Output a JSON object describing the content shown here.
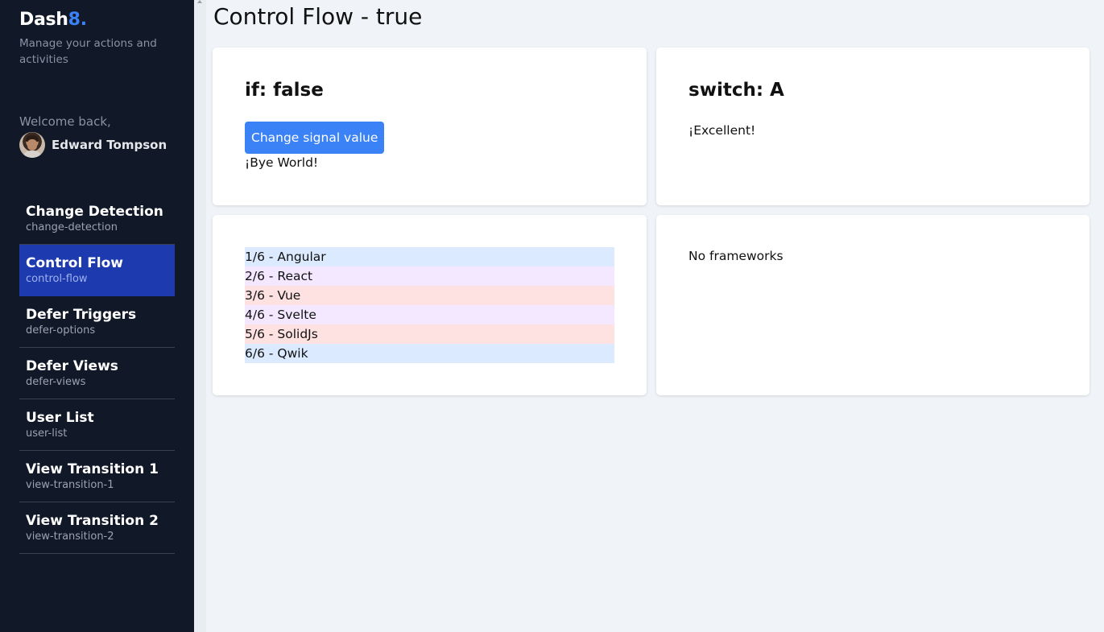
{
  "sidebar": {
    "brand_main": "Dash",
    "brand_accent": "8",
    "brand_suffix": ".",
    "tagline": "Manage your actions and activities",
    "welcome": "Welcome back,",
    "user_name": "Edward Tompson",
    "nav": [
      {
        "label": "Change Detection",
        "route": "change-detection",
        "active": false
      },
      {
        "label": "Control Flow",
        "route": "control-flow",
        "active": true
      },
      {
        "label": "Defer Triggers",
        "route": "defer-options",
        "active": false
      },
      {
        "label": "Defer Views",
        "route": "defer-views",
        "active": false
      },
      {
        "label": "User List",
        "route": "user-list",
        "active": false
      },
      {
        "label": "View Transition 1",
        "route": "view-transition-1",
        "active": false
      },
      {
        "label": "View Transition 2",
        "route": "view-transition-2",
        "active": false
      }
    ]
  },
  "main": {
    "title": "Control Flow - true",
    "if_card": {
      "heading": "if: false",
      "button_label": "Change signal value",
      "message": "¡Bye World!"
    },
    "switch_card": {
      "heading": "switch: A",
      "message": "¡Excellent!"
    },
    "framework_list": [
      {
        "text": "1/6 - Angular",
        "color": "#dbeafe"
      },
      {
        "text": "2/6 - React",
        "color": "#f3e8ff"
      },
      {
        "text": "3/6 - Vue",
        "color": "#fee2e2"
      },
      {
        "text": "4/6 - Svelte",
        "color": "#f3e8ff"
      },
      {
        "text": "5/6 - SolidJs",
        "color": "#fee2e2"
      },
      {
        "text": "6/6 - Qwik",
        "color": "#dbeafe"
      }
    ],
    "empty_card": {
      "message": "No frameworks"
    }
  },
  "colors": {
    "sidebar_bg": "#111827",
    "active_nav_bg": "#1e3aaf",
    "accent": "#3b82f6",
    "page_bg": "#f0f3f8"
  }
}
